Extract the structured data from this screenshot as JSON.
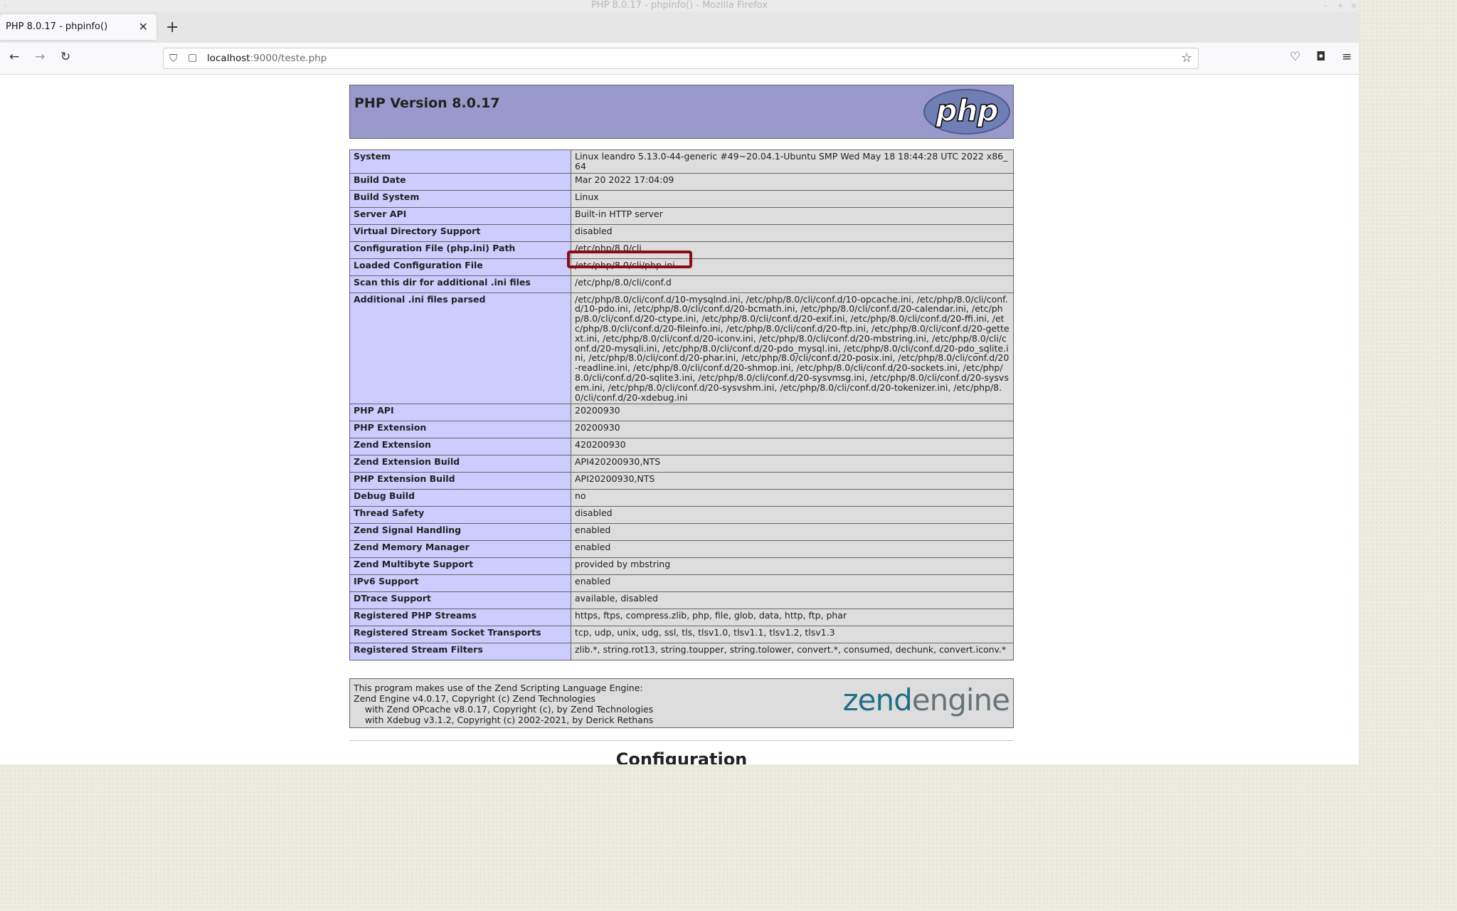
{
  "window": {
    "title": "PHP 8.0.17 - phpinfo() - Mozilla Firefox"
  },
  "tab": {
    "title": "PHP 8.0.17 - phpinfo()",
    "close": "✕",
    "new_tab": "+"
  },
  "url": {
    "host": "localhost",
    "path": ":9000/teste.php"
  },
  "header": {
    "title": "PHP Version 8.0.17",
    "logo": "php"
  },
  "info_rows": [
    {
      "key": "System",
      "value": "Linux leandro 5.13.0-44-generic #49~20.04.1-Ubuntu SMP Wed May 18 18:44:28 UTC 2022 x86_64"
    },
    {
      "key": "Build Date",
      "value": "Mar 20 2022 17:04:09"
    },
    {
      "key": "Build System",
      "value": "Linux"
    },
    {
      "key": "Server API",
      "value": "Built-in HTTP server"
    },
    {
      "key": "Virtual Directory Support",
      "value": "disabled"
    },
    {
      "key": "Configuration File (php.ini) Path",
      "value": "/etc/php/8.0/cli"
    },
    {
      "key": "Loaded Configuration File",
      "value": "/etc/php/8.0/cli/php.ini"
    },
    {
      "key": "Scan this dir for additional .ini files",
      "value": "/etc/php/8.0/cli/conf.d"
    },
    {
      "key": "Additional .ini files parsed",
      "value": "/etc/php/8.0/cli/conf.d/10-mysqlnd.ini, /etc/php/8.0/cli/conf.d/10-opcache.ini, /etc/php/8.0/cli/conf.d/10-pdo.ini, /etc/php/8.0/cli/conf.d/20-bcmath.ini, /etc/php/8.0/cli/conf.d/20-calendar.ini, /etc/php/8.0/cli/conf.d/20-ctype.ini, /etc/php/8.0/cli/conf.d/20-exif.ini, /etc/php/8.0/cli/conf.d/20-ffi.ini, /etc/php/8.0/cli/conf.d/20-fileinfo.ini, /etc/php/8.0/cli/conf.d/20-ftp.ini, /etc/php/8.0/cli/conf.d/20-gettext.ini, /etc/php/8.0/cli/conf.d/20-iconv.ini, /etc/php/8.0/cli/conf.d/20-mbstring.ini, /etc/php/8.0/cli/conf.d/20-mysqli.ini, /etc/php/8.0/cli/conf.d/20-pdo_mysql.ini, /etc/php/8.0/cli/conf.d/20-pdo_sqlite.ini, /etc/php/8.0/cli/conf.d/20-phar.ini, /etc/php/8.0/cli/conf.d/20-posix.ini, /etc/php/8.0/cli/conf.d/20-readline.ini, /etc/php/8.0/cli/conf.d/20-shmop.ini, /etc/php/8.0/cli/conf.d/20-sockets.ini, /etc/php/8.0/cli/conf.d/20-sqlite3.ini, /etc/php/8.0/cli/conf.d/20-sysvmsg.ini, /etc/php/8.0/cli/conf.d/20-sysvsem.ini, /etc/php/8.0/cli/conf.d/20-sysvshm.ini, /etc/php/8.0/cli/conf.d/20-tokenizer.ini, /etc/php/8.0/cli/conf.d/20-xdebug.ini"
    },
    {
      "key": "PHP API",
      "value": "20200930"
    },
    {
      "key": "PHP Extension",
      "value": "20200930"
    },
    {
      "key": "Zend Extension",
      "value": "420200930"
    },
    {
      "key": "Zend Extension Build",
      "value": "API420200930,NTS"
    },
    {
      "key": "PHP Extension Build",
      "value": "API20200930,NTS"
    },
    {
      "key": "Debug Build",
      "value": "no"
    },
    {
      "key": "Thread Safety",
      "value": "disabled"
    },
    {
      "key": "Zend Signal Handling",
      "value": "enabled"
    },
    {
      "key": "Zend Memory Manager",
      "value": "enabled"
    },
    {
      "key": "Zend Multibyte Support",
      "value": "provided by mbstring"
    },
    {
      "key": "IPv6 Support",
      "value": "enabled"
    },
    {
      "key": "DTrace Support",
      "value": "available, disabled"
    },
    {
      "key": "Registered PHP Streams",
      "value": "https, ftps, compress.zlib, php, file, glob, data, http, ftp, phar"
    },
    {
      "key": "Registered Stream Socket Transports",
      "value": "tcp, udp, unix, udg, ssl, tls, tlsv1.0, tlsv1.1, tlsv1.2, tlsv1.3"
    },
    {
      "key": "Registered Stream Filters",
      "value": "zlib.*, string.rot13, string.toupper, string.tolower, convert.*, consumed, dechunk, convert.iconv.*"
    }
  ],
  "zend": {
    "lines": [
      "This program makes use of the Zend Scripting Language Engine:",
      "Zend Engine v4.0.17, Copyright (c) Zend Technologies",
      "    with Zend OPcache v8.0.17, Copyright (c), by Zend Technologies",
      "    with Xdebug v3.1.2, Copyright (c) 2002-2021, by Derick Rethans"
    ],
    "logo_zend": "zend",
    "logo_engine": "engine"
  },
  "section_heading": "Configuration",
  "colors": {
    "header_bg": "#9999cc",
    "key_bg": "#ccccff",
    "value_bg": "#dddddd",
    "highlight": "#8b0b16"
  }
}
